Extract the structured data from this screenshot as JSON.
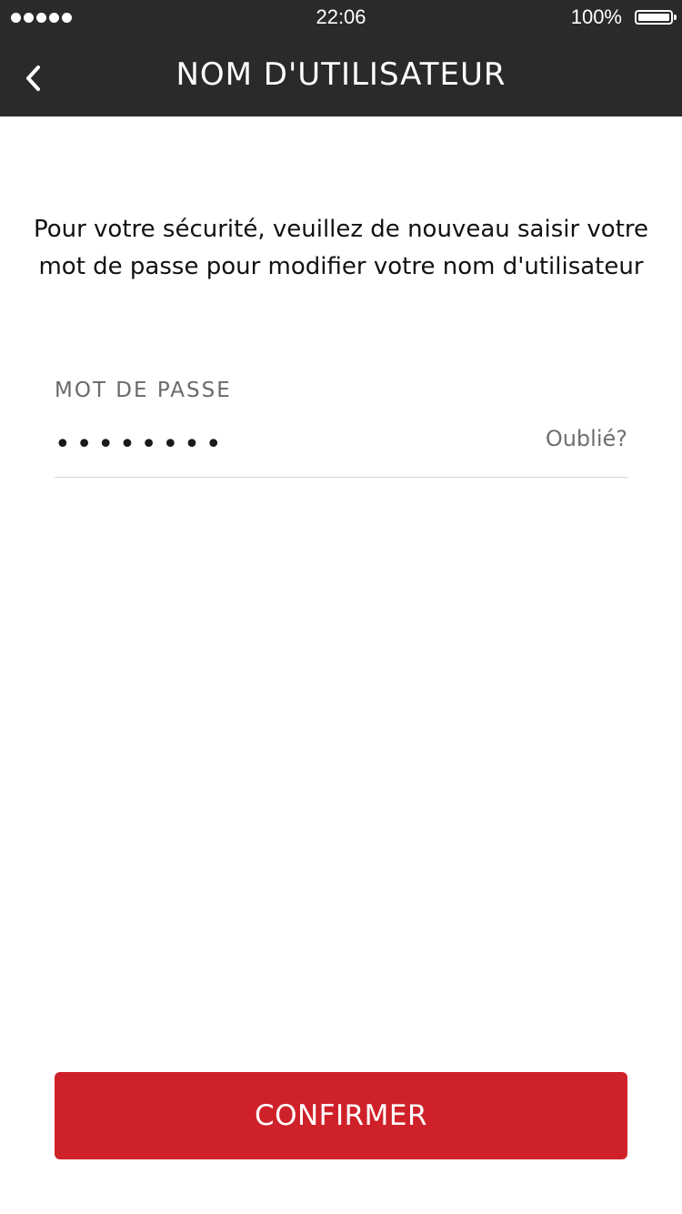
{
  "status_bar": {
    "time": "22:06",
    "battery": "100%",
    "signal_icon": "signal-dots-icon",
    "battery_icon": "battery-icon"
  },
  "nav": {
    "back_icon": "chevron-left-icon",
    "title": "NOM D'UTILISATEUR"
  },
  "instructions": "Pour votre sécurité, veuillez de nouveau saisir votre mot de passe pour modifier votre nom d'utilisateur",
  "password_field": {
    "label": "MOT DE PASSE",
    "value": "••••••••",
    "forgot_link": "Oublié?"
  },
  "confirm_button": "CONFIRMER",
  "colors": {
    "header_bg": "#2a2a2a",
    "accent": "#cf2129"
  }
}
